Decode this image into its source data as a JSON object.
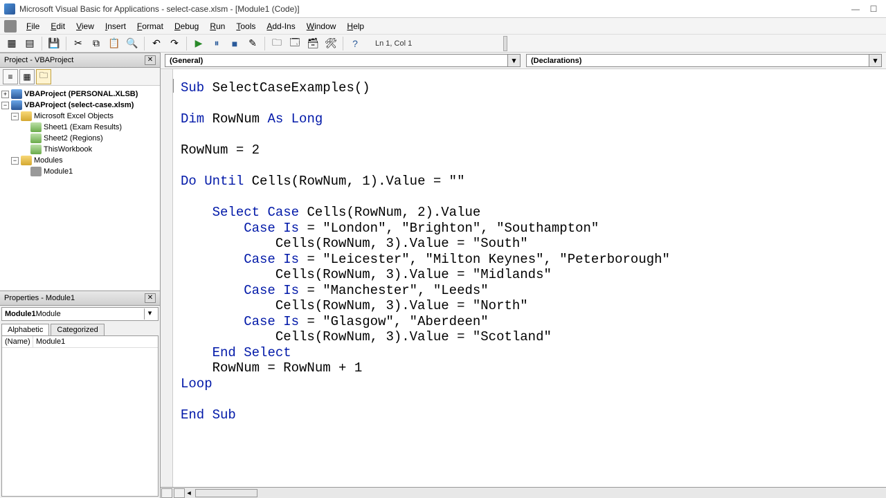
{
  "titlebar": {
    "text": "Microsoft Visual Basic for Applications - select-case.xlsm - [Module1 (Code)]"
  },
  "menu": [
    "File",
    "Edit",
    "View",
    "Insert",
    "Format",
    "Debug",
    "Run",
    "Tools",
    "Add-Ins",
    "Window",
    "Help"
  ],
  "toolbar_status": "Ln 1, Col 1",
  "project_panel": {
    "title": "Project - VBAProject",
    "tree": {
      "p1": "VBAProject (PERSONAL.XLSB)",
      "p2": "VBAProject (select-case.xlsm)",
      "excel_objs": "Microsoft Excel Objects",
      "sheet1": "Sheet1 (Exam Results)",
      "sheet2": "Sheet2 (Regions)",
      "thiswb": "ThisWorkbook",
      "modules": "Modules",
      "module1": "Module1"
    }
  },
  "properties_panel": {
    "title": "Properties - Module1",
    "selector_bold": "Module1",
    "selector_rest": " Module",
    "tabs": [
      "Alphabetic",
      "Categorized"
    ],
    "rows": [
      {
        "k": "(Name)",
        "v": "Module1"
      }
    ]
  },
  "dropdowns": {
    "left": "(General)",
    "right": "(Declarations)"
  },
  "code_keywords": [
    "Sub",
    "Dim",
    "As",
    "Long",
    "Do",
    "Until",
    "Select",
    "Case",
    "Is",
    "End",
    "Loop"
  ],
  "code_lines": [
    "Sub SelectCaseExamples()",
    "",
    "Dim RowNum As Long",
    "",
    "RowNum = 2",
    "",
    "Do Until Cells(RowNum, 1).Value = \"\"",
    "",
    "    Select Case Cells(RowNum, 2).Value",
    "        Case Is = \"London\", \"Brighton\", \"Southampton\"",
    "            Cells(RowNum, 3).Value = \"South\"",
    "        Case Is = \"Leicester\", \"Milton Keynes\", \"Peterborough\"",
    "            Cells(RowNum, 3).Value = \"Midlands\"",
    "        Case Is = \"Manchester\", \"Leeds\"",
    "            Cells(RowNum, 3).Value = \"North\"",
    "        Case Is = \"Glasgow\", \"Aberdeen\"",
    "            Cells(RowNum, 3).Value = \"Scotland\"",
    "    End Select",
    "    RowNum = RowNum + 1",
    "Loop",
    "",
    "End Sub"
  ]
}
